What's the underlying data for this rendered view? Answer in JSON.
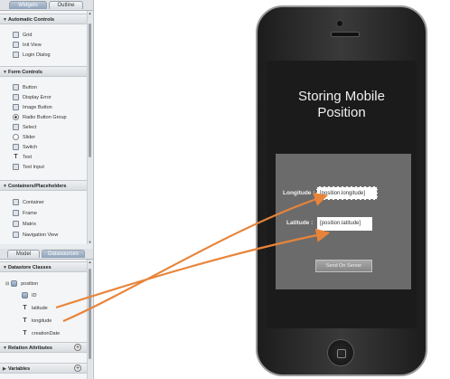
{
  "left_panel": {
    "top_tabs": [
      "Widgets",
      "Outline"
    ],
    "bottom_tabs": [
      "Model",
      "Datasources"
    ],
    "widget_sections": [
      {
        "title": "Automatic Controls",
        "items": [
          {
            "label": "Grid",
            "icon": "grid-icon"
          },
          {
            "label": "Init View",
            "icon": "view-icon"
          },
          {
            "label": "Login Dialog",
            "icon": "login-icon"
          }
        ]
      },
      {
        "title": "Form Controls",
        "items": [
          {
            "label": "Button",
            "icon": "button-icon"
          },
          {
            "label": "Display Error",
            "icon": "error-icon"
          },
          {
            "label": "Image Button",
            "icon": "image-button-icon"
          },
          {
            "label": "Radio Button Group",
            "icon": "radio-icon"
          },
          {
            "label": "Select",
            "icon": "select-icon"
          },
          {
            "label": "Slider",
            "icon": "slider-icon"
          },
          {
            "label": "Switch",
            "icon": "switch-icon"
          },
          {
            "label": "Text",
            "icon": "text-icon"
          },
          {
            "label": "Text Input",
            "icon": "text-input-icon"
          }
        ]
      },
      {
        "title": "Containers/Placeholders",
        "items": [
          {
            "label": "Container",
            "icon": "container-icon"
          },
          {
            "label": "Frame",
            "icon": "frame-icon"
          },
          {
            "label": "Matrix",
            "icon": "matrix-icon"
          },
          {
            "label": "Navigation View",
            "icon": "navigation-icon"
          }
        ]
      }
    ],
    "datasource_sections": [
      {
        "title": "Datastore Classes"
      },
      {
        "title": "Relation Attributes"
      },
      {
        "title": "Variables"
      }
    ],
    "datastore_class": "position",
    "attributes": [
      "ID",
      "latitude",
      "longitude",
      "creationDate"
    ],
    "add_symbol": "+"
  },
  "phone": {
    "app_title_line1": "Storing Mobile",
    "app_title_line2": "Position",
    "longitude_label": "Longitude :",
    "longitude_value": "[position.longitude]",
    "latitude_label": "Latitude :",
    "latitude_value": "[position.latitude]",
    "send_button_label": "Send On Server"
  },
  "colors": {
    "arrow": "#e8843a",
    "accent_tab": "#8fa3ba",
    "screen_bg": "#1b1b1b",
    "form_bg": "#6b6b6b"
  }
}
